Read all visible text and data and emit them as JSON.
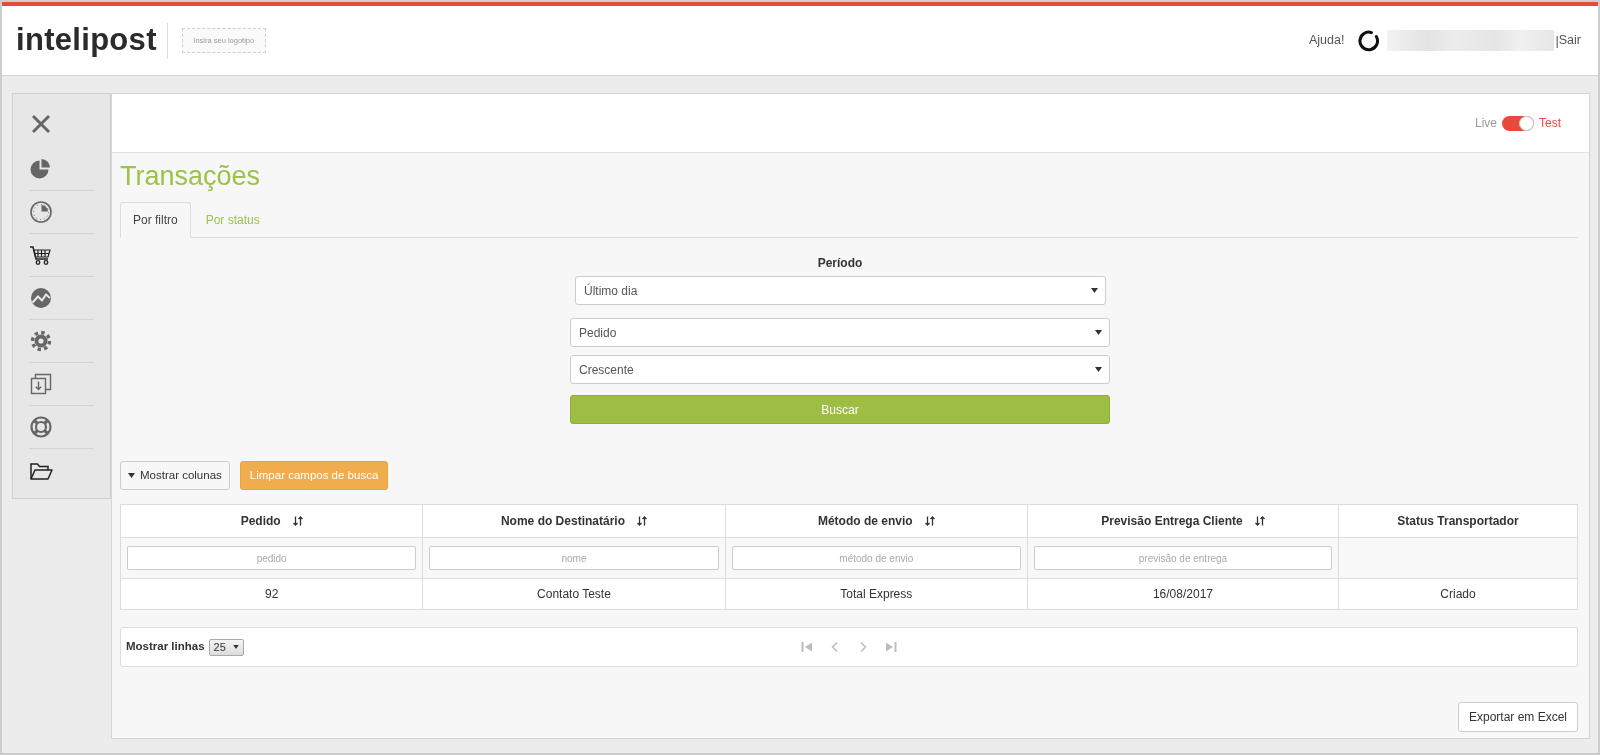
{
  "header": {
    "logo": "intelipost",
    "logo_placeholder": "Insira seu logotipo",
    "help": "Ajuda!",
    "separator": "|",
    "logout": "Sair"
  },
  "mode_switch": {
    "left_label": "Live",
    "right_label": "Test",
    "on": true
  },
  "page": {
    "title": "Transações"
  },
  "tabs": [
    {
      "label": "Por filtro",
      "selected": true
    },
    {
      "label": "Por status",
      "selected": false
    }
  ],
  "filters": {
    "period_label": "Período",
    "selects": [
      {
        "value": "Último dia"
      },
      {
        "value": "Pedido"
      },
      {
        "value": "Crescente"
      }
    ],
    "search_button": "Buscar"
  },
  "toolbar": {
    "columns_button": "Mostrar colunas",
    "clear_button": "Limpar campos de busca"
  },
  "table": {
    "columns": [
      {
        "label": "Pedido",
        "sortable": true,
        "placeholder": "pedido"
      },
      {
        "label": "Nome do Destinatário",
        "sortable": true,
        "placeholder": "nome"
      },
      {
        "label": "Método de envio",
        "sortable": true,
        "placeholder": "método de envio"
      },
      {
        "label": "Previsão Entrega Cliente",
        "sortable": true,
        "placeholder": "previsão de entrega"
      },
      {
        "label": "Status Transportador",
        "sortable": false
      }
    ],
    "rows": [
      [
        "92",
        "Contato Teste",
        "Total Express",
        "16/08/2017",
        "Criado"
      ]
    ]
  },
  "pagination": {
    "label": "Mostrar linhas",
    "page_size": "25",
    "buttons": [
      {
        "kind": "first",
        "disabled": true
      },
      {
        "kind": "previous",
        "disabled": true
      },
      {
        "kind": "next",
        "disabled": true
      },
      {
        "kind": "last",
        "disabled": true
      }
    ]
  },
  "export_button": "Exportar em Excel"
}
